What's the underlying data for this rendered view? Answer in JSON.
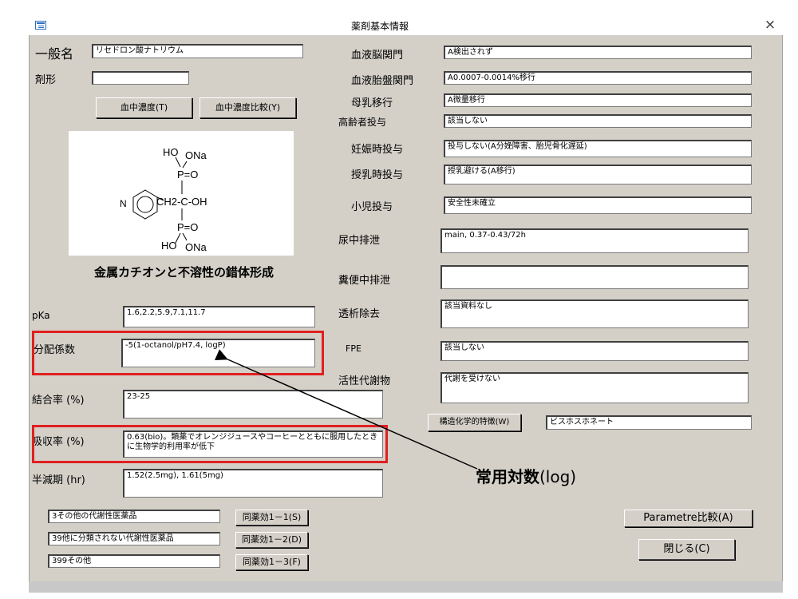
{
  "window": {
    "title": "薬剤基本情報",
    "close_glyph": "×",
    "icon": "form-icon"
  },
  "left": {
    "generic_name_label": "一般名",
    "generic_name_value": "リセドロン酸ナトリウム",
    "dosage_form_label": "剤形",
    "dosage_form_value": "",
    "btn_blood_conc": "血中濃度(T)",
    "btn_blood_conc_compare": "血中濃度比較(Y)",
    "structure": {
      "ho_top": "HO",
      "ona_top": "ONa",
      "p_top": "P=O",
      "n_ring": "N",
      "ch2_c_oh": "CH2-C-OH",
      "p_bottom": "P=O",
      "ho_bottom": "HO",
      "ona_bottom": "ONa"
    },
    "structure_caption": "金属カチオンと不溶性の錯体形成",
    "pka_label": "pKa",
    "pka_value": "1.6,2.2,5.9,7.1,11.7",
    "partition_label": "分配係数",
    "partition_value": "-5(1-octanol/pH7.4, logP)",
    "binding_label": "結合率 (%)",
    "binding_value": "23-25",
    "absorption_label": "吸収率 (%)",
    "absorption_value": "0.63(bio)。類薬でオレンジジュースやコーヒーとともに服用したときに生物学的利用率が低下",
    "halflife_label": "半減期 (hr)",
    "halflife_value": "1.52(2.5mg), 1.61(5mg)",
    "categories": [
      {
        "name": "3その他の代謝性医薬品",
        "button": "同薬効1－1(S)"
      },
      {
        "name": "39他に分類されない代謝性医薬品",
        "button": "同薬効1－2(D)"
      },
      {
        "name": "399その他",
        "button": "同薬効1－3(F)"
      }
    ]
  },
  "right": {
    "bbb_label": "血液脳関門",
    "bbb_value": "A検出されず",
    "placenta_label": "血液胎盤関門",
    "placenta_value": "A0.0007-0.0014%移行",
    "breastmilk_label": "母乳移行",
    "breastmilk_value": "A微量移行",
    "elderly_label": "高齢者投与",
    "elderly_value": "該当しない",
    "pregnancy_label": "妊娠時投与",
    "pregnancy_value": "投与しない(A分娩障害、胎児骨化遅延)",
    "lactation_label": "授乳時投与",
    "lactation_value": "授乳避ける(A移行)",
    "pediatric_label": "小児投与",
    "pediatric_value": "安全性未確立",
    "urine_label": "尿中排泄",
    "urine_value": "main, 0.37-0.43/72h",
    "fecal_label": "糞便中排泄",
    "fecal_value": "",
    "dialysis_label": "透析除去",
    "dialysis_value": "該当資料なし",
    "fpe_label": "FPE",
    "fpe_value": "該当しない",
    "metabolite_label": "活性代謝物",
    "metabolite_value": "代謝を受けない",
    "structure_btn": "構造化学的特徴(W)",
    "structure_value": "ビスホスホネート",
    "param_btn": "Parametre比較(A)",
    "close_btn": "閉じる(C)"
  },
  "annotation": {
    "main": "常用対数",
    "sub": "(log)",
    "color": "#e02020"
  }
}
